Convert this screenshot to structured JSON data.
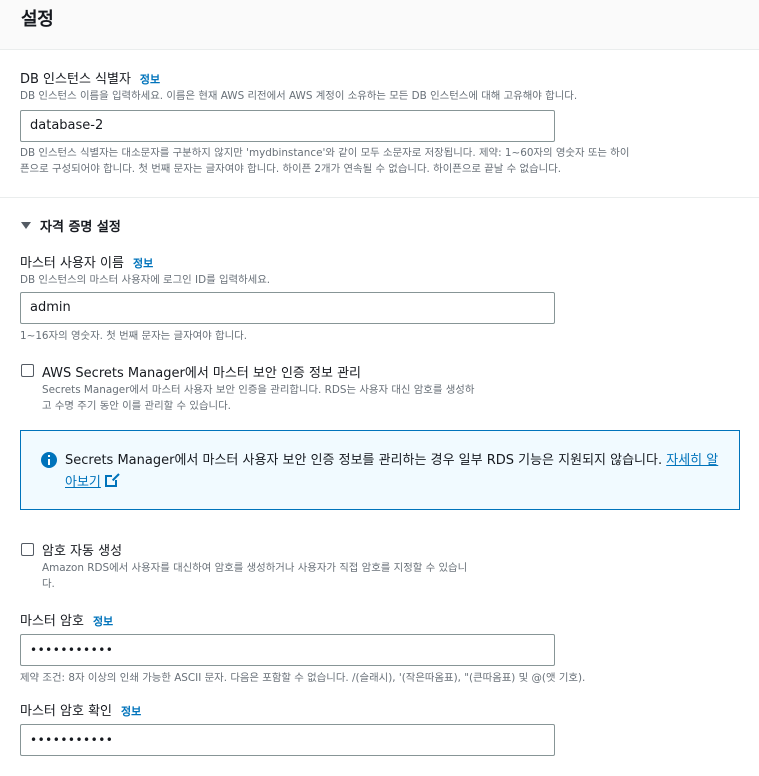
{
  "header": {
    "title": "설정"
  },
  "db_identifier": {
    "label": "DB 인스턴스 식별자",
    "info": "정보",
    "description": "DB 인스턴스 이름을 입력하세요. 이름은 현재 AWS 리전에서 AWS 계정이 소유하는 모든 DB 인스턴스에 대해 고유해야 합니다.",
    "value": "database-2",
    "hint_line1": "DB 인스턴스 식별자는 대소문자를 구분하지 않지만 'mydbinstance'와 같이 모두 소문자로 저장됩니다. 제약: 1~60자의 영숫자 또는 하이",
    "hint_line2": "픈으로 구성되어야 합니다. 첫 번째 문자는 글자여야 합니다. 하이픈 2개가 연속될 수 없습니다. 하이픈으로 끝날 수 없습니다."
  },
  "credentials": {
    "section_title": "자격 증명 설정",
    "master_username": {
      "label": "마스터 사용자 이름",
      "info": "정보",
      "description": "DB 인스턴스의 마스터 사용자에 로그인 ID를 입력하세요.",
      "value": "admin",
      "hint": "1~16자의 영숫자. 첫 번째 문자는 글자여야 합니다."
    },
    "secrets_manager": {
      "checked": false,
      "label": "AWS Secrets Manager에서 마스터 보안 인증 정보 관리",
      "description_line1": "Secrets Manager에서 마스터 사용자 보안 인증을 관리합니다. RDS는 사용자 대신 암호를 생성하",
      "description_line2": "고 수명 주기 동안 이를 관리할 수 있습니다."
    },
    "alert": {
      "text": "Secrets Manager에서 마스터 사용자 보안 인증 정보를 관리하는 경우 일부 RDS 기능은 지원되지 않습니다.",
      "link": "자세히 알아보기"
    },
    "auto_generate": {
      "checked": false,
      "label": "암호 자동 생성",
      "description_line1": "Amazon RDS에서 사용자를 대신하여 암호를 생성하거나 사용자가 직접 암호를 지정할 수 있습니",
      "description_line2": "다."
    },
    "master_password": {
      "label": "마스터 암호",
      "info": "정보",
      "value": "•••••••••••",
      "hint": "제약 조건: 8자 이상의 인쇄 가능한 ASCII 문자. 다음은 포함할 수 없습니다. /(슬래시), '(작은따옴표), \"(큰따옴표) 및 @(앳 기호)."
    },
    "confirm_password": {
      "label": "마스터 암호 확인",
      "info": "정보",
      "value": "•••••••••••"
    }
  },
  "colors": {
    "link": "#0073bb",
    "text": "#16191f",
    "muted": "#687078",
    "border": "#879596",
    "alert_bg": "#f1faff"
  }
}
